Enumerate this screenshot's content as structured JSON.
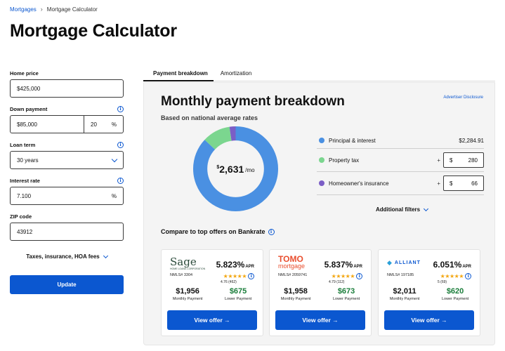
{
  "breadcrumb": {
    "root": "Mortgages",
    "current": "Mortgage Calculator"
  },
  "page_title": "Mortgage Calculator",
  "form": {
    "home_price": {
      "label": "Home price",
      "value": "$425,000"
    },
    "down_payment": {
      "label": "Down payment",
      "value": "$85,000",
      "percent": "20",
      "percent_unit": "%"
    },
    "loan_term": {
      "label": "Loan term",
      "value": "30 years"
    },
    "interest_rate": {
      "label": "Interest rate",
      "value": "7.100",
      "unit": "%"
    },
    "zip": {
      "label": "ZIP code",
      "value": "43912"
    },
    "taxes_toggle": "Taxes, insurance, HOA fees",
    "update_label": "Update"
  },
  "tabs": [
    {
      "label": "Payment breakdown",
      "active": true
    },
    {
      "label": "Amortization",
      "active": false
    }
  ],
  "breakdown": {
    "title": "Monthly payment breakdown",
    "subtitle": "Based on national average rates",
    "disclosure": "Advertiser Disclosure",
    "total_currency": "$",
    "total_value": "2,631",
    "total_suffix": "/mo",
    "items": [
      {
        "label": "Principal & interest",
        "value": "$2,284.91",
        "color": "#4a90e2",
        "amount": 2284.91
      },
      {
        "label": "Property tax",
        "currency": "$",
        "value": "280",
        "color": "#7bd68f",
        "amount": 280
      },
      {
        "label": "Homeowner's insurance",
        "currency": "$",
        "value": "66",
        "color": "#7b5ec6",
        "amount": 66
      }
    ],
    "additional_filters": "Additional filters"
  },
  "compare": {
    "title": "Compare to top offers on Bankrate",
    "offers": [
      {
        "lender": "Sage",
        "lender_sub": "HOME LOANS CORPORATION",
        "rate": "5.823%",
        "apr": "APR",
        "nmls": "NMLS# 3304",
        "score": "4.76 (462)",
        "monthly": "$1,956",
        "monthly_label": "Monthly Payment",
        "lower": "$675",
        "lower_label": "Lower Payment",
        "cta": "View offer →"
      },
      {
        "lender": "TOMO",
        "lender_sub": "mortgage",
        "rate": "5.837%",
        "apr": "APR",
        "nmls": "NMLS# 2059741",
        "score": "4.79 (112)",
        "monthly": "$1,958",
        "monthly_label": "Monthly Payment",
        "lower": "$673",
        "lower_label": "Lower Payment",
        "cta": "View offer →"
      },
      {
        "lender": "ALLIANT",
        "lender_sub": "",
        "rate": "6.051%",
        "apr": "APR",
        "nmls": "NMLS# 197185",
        "score": "5 (69)",
        "monthly": "$2,011",
        "monthly_label": "Monthly Payment",
        "lower": "$620",
        "lower_label": "Lower Payment",
        "cta": "View offer →"
      }
    ]
  }
}
